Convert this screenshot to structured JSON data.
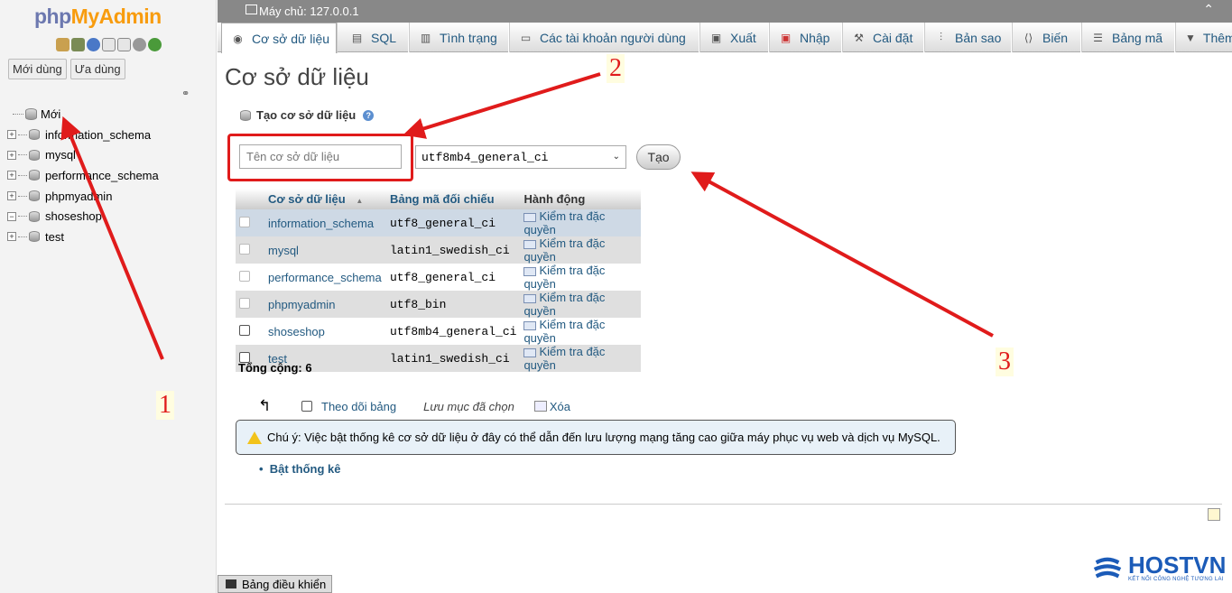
{
  "nav": {
    "logo_php": "php",
    "logo_myadmin": "MyAdmin",
    "tab_recent": "Mới dùng",
    "tab_favorites": "Ưa dùng",
    "tree": [
      {
        "label": "Mới",
        "type": "new"
      },
      {
        "label": "information_schema",
        "type": "db"
      },
      {
        "label": "mysql",
        "type": "db"
      },
      {
        "label": "performance_schema",
        "type": "db"
      },
      {
        "label": "phpmyadmin",
        "type": "db"
      },
      {
        "label": "shoseshop",
        "type": "db"
      },
      {
        "label": "test",
        "type": "db"
      }
    ]
  },
  "topbar": {
    "server": "Máy chủ: 127.0.0.1"
  },
  "tabs": [
    {
      "label": "Cơ sở dữ liệu",
      "icon": "database-icon"
    },
    {
      "label": "SQL",
      "icon": "sql-icon"
    },
    {
      "label": "Tình trạng",
      "icon": "status-icon"
    },
    {
      "label": "Các tài khoản người dùng",
      "icon": "users-icon"
    },
    {
      "label": "Xuất",
      "icon": "export-icon"
    },
    {
      "label": "Nhập",
      "icon": "import-icon"
    },
    {
      "label": "Cài đặt",
      "icon": "settings-icon"
    },
    {
      "label": "Bản sao",
      "icon": "replication-icon"
    },
    {
      "label": "Biến",
      "icon": "variables-icon"
    },
    {
      "label": "Bảng mã",
      "icon": "charset-icon"
    },
    {
      "label": "Thêm",
      "icon": "more-icon"
    }
  ],
  "main": {
    "title": "Cơ sở dữ liệu",
    "create_label": "Tạo cơ sở dữ liệu",
    "db_name_placeholder": "Tên cơ sở dữ liệu",
    "collation_value": "utf8mb4_general_ci",
    "create_button": "Tạo",
    "table_headers": {
      "name": "Cơ sở dữ liệu",
      "collation": "Bảng mã đối chiếu",
      "action": "Hành động"
    },
    "rows": [
      {
        "name": "information_schema",
        "collation": "utf8_general_ci",
        "action": "Kiểm tra đặc quyền"
      },
      {
        "name": "mysql",
        "collation": "latin1_swedish_ci",
        "action": "Kiểm tra đặc quyền"
      },
      {
        "name": "performance_schema",
        "collation": "utf8_general_ci",
        "action": "Kiểm tra đặc quyền"
      },
      {
        "name": "phpmyadmin",
        "collation": "utf8_bin",
        "action": "Kiểm tra đặc quyền"
      },
      {
        "name": "shoseshop",
        "collation": "utf8mb4_general_ci",
        "action": "Kiểm tra đặc quyền"
      },
      {
        "name": "test",
        "collation": "latin1_swedish_ci",
        "action": "Kiểm tra đặc quyền"
      }
    ],
    "total": "Tổng cộng: 6",
    "check_all": "Theo dõi bảng",
    "with_selected": "Lưu mục đã chọn",
    "delete": "Xóa",
    "notice": "Chú ý: Việc bật thống kê cơ sở dữ liệu ở đây có thể dẫn đến lưu lượng mạng tăng cao giữa máy phục vụ web và dịch vụ MySQL.",
    "enable_stats": "Bật thống kê",
    "console": "Bảng điều khiển"
  },
  "annotations": {
    "n1": "1",
    "n2": "2",
    "n3": "3",
    "color": "#e01b1b"
  },
  "brand": {
    "name": "HOSTVN",
    "tagline": "KẾT NỐI CÔNG NGHỆ TƯƠNG LAI"
  }
}
